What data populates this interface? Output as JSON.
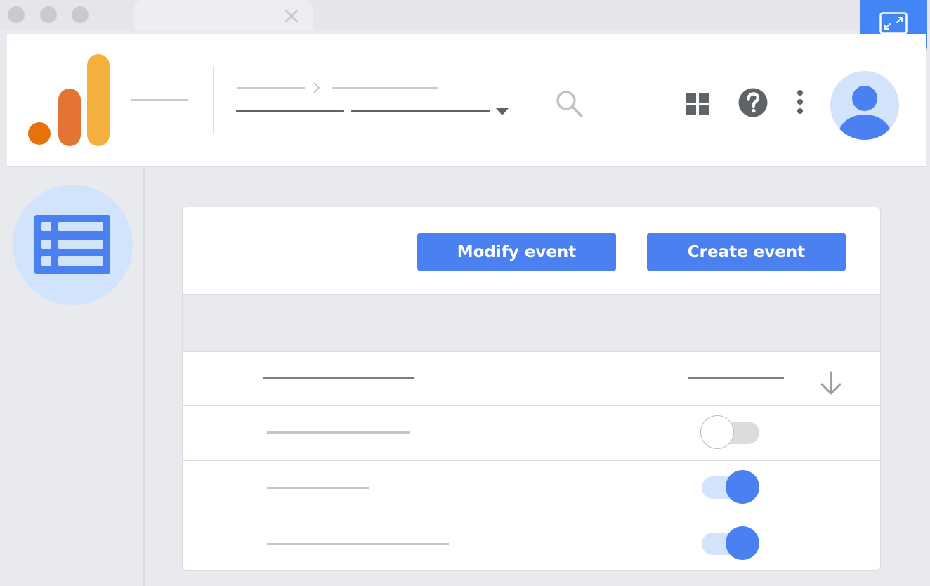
{
  "browser": {
    "traffic_lights": [
      "close",
      "minimize",
      "maximize"
    ],
    "tab": {
      "close_icon": "close-icon"
    },
    "expand_icon": "exit-fullscreen-icon"
  },
  "header": {
    "logo": "analytics-logo",
    "logo_colors": [
      "#e8710a",
      "#e37433",
      "#f4b03e"
    ],
    "icons": [
      "search-icon",
      "apps-grid-icon",
      "help-icon",
      "more-vert-icon",
      "account-avatar-icon"
    ]
  },
  "sidebar": {
    "icon": "list-view-icon"
  },
  "actions": {
    "modify_label": "Modify event",
    "create_label": "Create event"
  },
  "table": {
    "sort_icon": "arrow-down-icon",
    "rows": [
      {
        "enabled": false
      },
      {
        "enabled": true
      },
      {
        "enabled": true
      }
    ]
  },
  "colors": {
    "accent": "#4a80f0",
    "toggle_on_track": "#d2e3fc",
    "toggle_off_track": "#dcdcdc"
  }
}
